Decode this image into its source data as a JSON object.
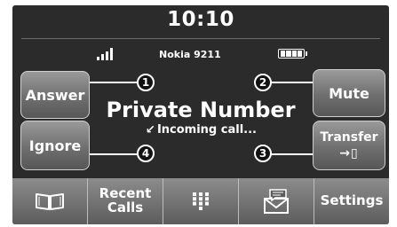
{
  "status_bar": {
    "time": "10:10",
    "carrier": "Nokia 9211",
    "signal_bars": 4,
    "battery_level": 1.0
  },
  "call": {
    "caller": "Private Number",
    "status": "Incoming call..."
  },
  "buttons": {
    "answer": "Answer",
    "ignore": "Ignore",
    "mute": "Mute",
    "transfer": "Transfer"
  },
  "callouts": [
    "1",
    "2",
    "3",
    "4"
  ],
  "bottom_bar": {
    "recent_calls_line1": "Recent",
    "recent_calls_line2": "Calls",
    "settings": "Settings"
  },
  "icons": {
    "phonebook": "phonebook-icon",
    "keypad": "keypad-icon",
    "messages": "messages-icon",
    "transfer": "transfer-to-phone-icon",
    "incoming": "incoming-arrow-icon"
  }
}
